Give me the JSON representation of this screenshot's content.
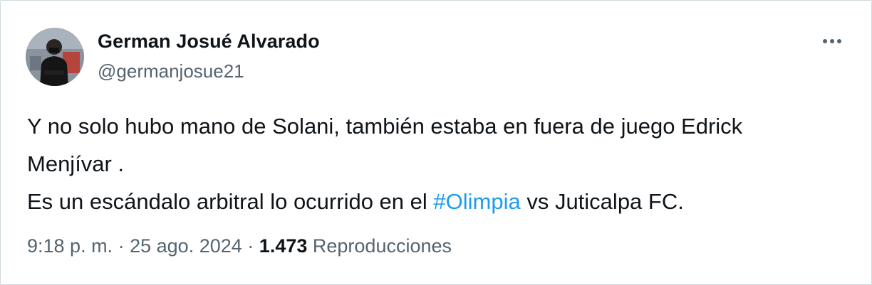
{
  "tweet": {
    "author_name": "German Josué Alvarado",
    "author_handle": "@germanjosue21",
    "more_icon": "ellipsis-icon",
    "text": {
      "line1": "Y no solo hubo mano de Solani, también estaba en fuera de juego Edrick",
      "line2": "Menjívar .",
      "line3_before": "Es un escándalo arbitral lo ocurrido en el ",
      "hashtag": "#Olimpia",
      "line3_after": " vs Juticalpa FC."
    },
    "time": "9:18 p. m.",
    "separator": "·",
    "date": "25 ago. 2024",
    "views_count": "1.473",
    "views_label": "Reproducciones"
  },
  "colors": {
    "text": "#0f1419",
    "secondary": "#536471",
    "link": "#1d9bf0",
    "border": "#cfd9de"
  }
}
